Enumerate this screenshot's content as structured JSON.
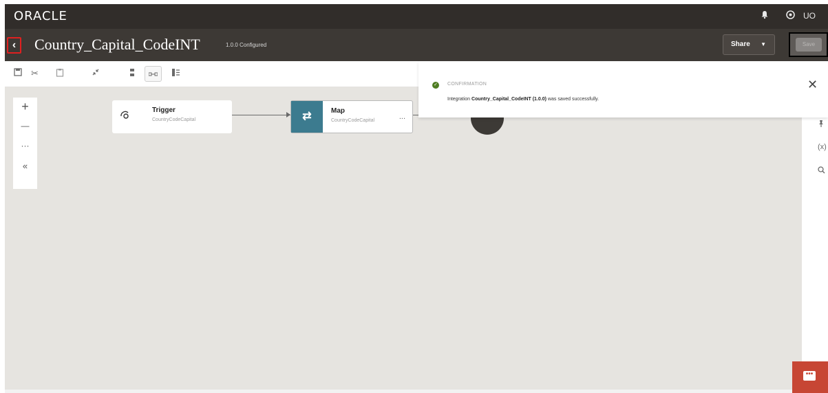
{
  "topbar": {
    "logo": "ORACLE",
    "notification_icon": "bell-icon",
    "help_icon": "help-circle-icon",
    "user_initials": "UO"
  },
  "titlebar": {
    "back_glyph": "‹",
    "title": "Country_Capital_CodeINT",
    "version_status": "1.0.0 Configured",
    "share_label": "Share",
    "share_caret": "▼",
    "save_label": "Save"
  },
  "toolbar": {
    "icons": [
      "save-icon",
      "cut-icon",
      "paste-icon",
      "collapse-icon",
      "vertical-layout-icon",
      "horizontal-layout-icon",
      "pseudo-view-icon"
    ]
  },
  "zoom": {
    "zoom_in": "+",
    "zoom_out": "—",
    "more": "···",
    "collapse": "«"
  },
  "nodes": {
    "trigger": {
      "title": "Trigger",
      "subtitle": "CountryCodeCapital"
    },
    "map": {
      "icon_glyph": "⇄",
      "title": "Map",
      "subtitle": "CountryCodeCapital",
      "more": "..."
    }
  },
  "toast": {
    "header": "CONFIRMATION",
    "message_prefix": "Integration",
    "integration_name": "Country_Capital_CodeINT (1.0.0)",
    "message_suffix": "was saved successfully.",
    "close_glyph": "✕"
  },
  "right_rail": {
    "icons": [
      "pin-icon",
      "variables-icon",
      "search-icon"
    ],
    "variables_label": "(x)"
  },
  "colors": {
    "header_bg": "#312d2a",
    "titlebar_bg": "#3d3935",
    "canvas_bg": "#e6e4e0",
    "map_icon_bg": "#3c7b8f",
    "chat_button": "#c74634",
    "success_green": "#4f7d22"
  }
}
